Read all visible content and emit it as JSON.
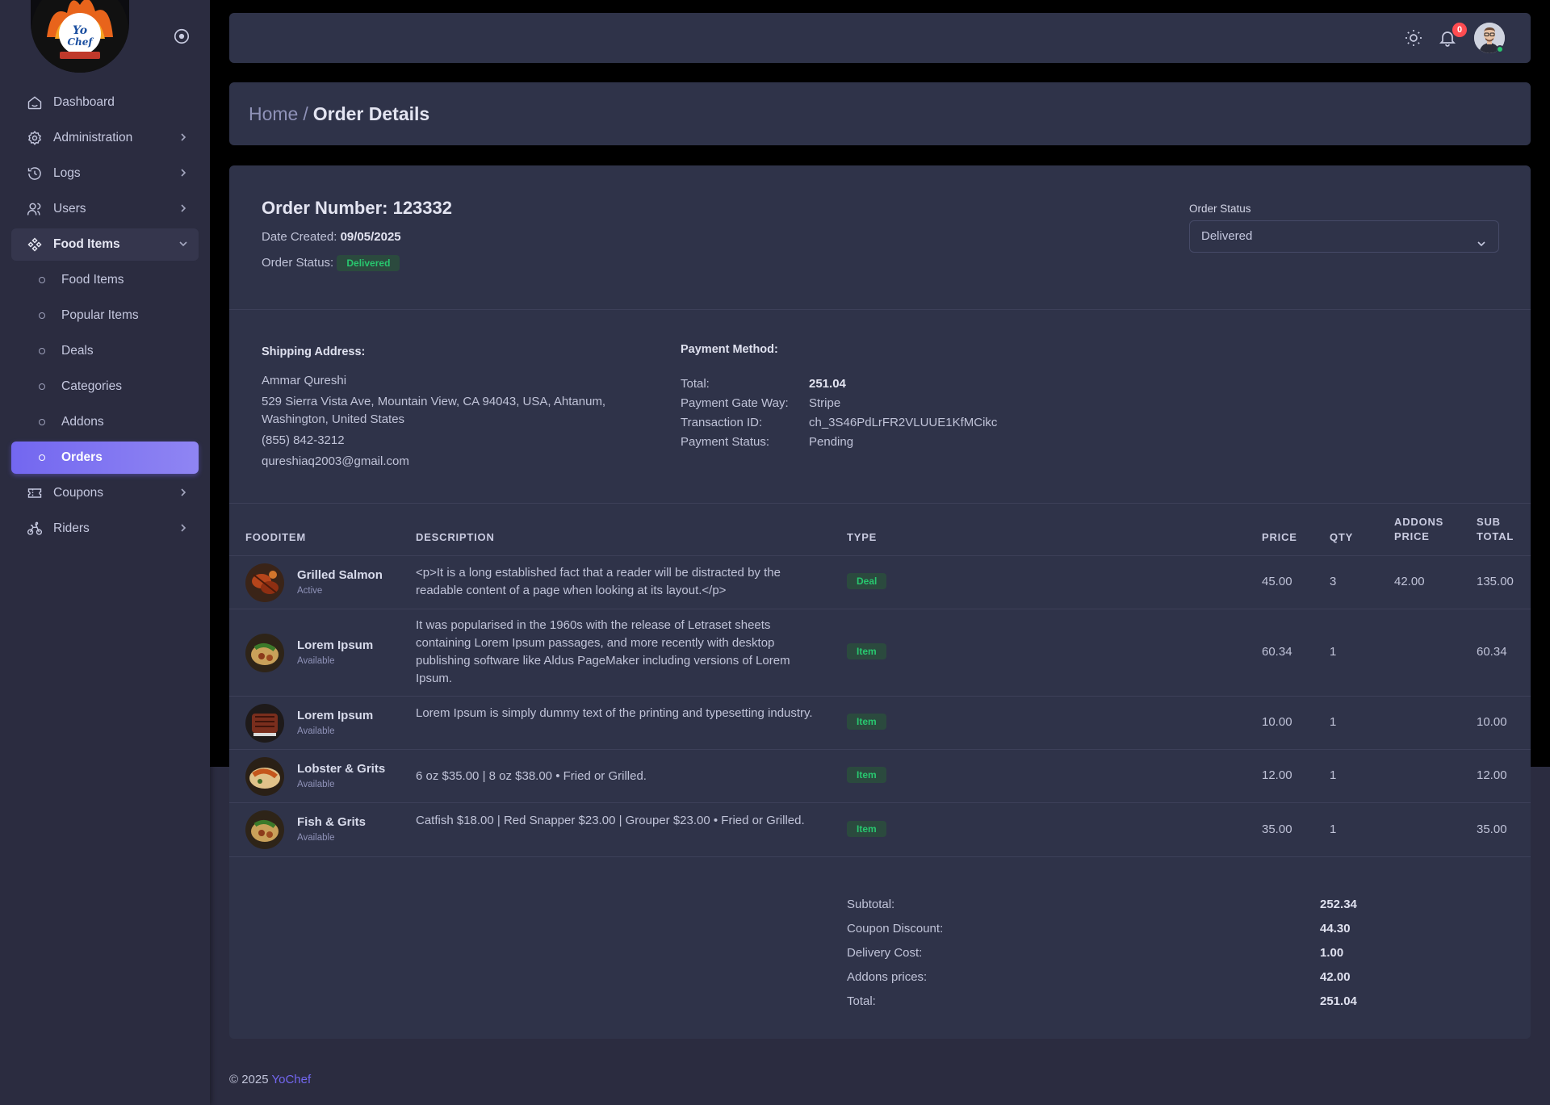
{
  "sidebar": {
    "logo_alt": "YoChef",
    "items": [
      {
        "label": "Dashboard",
        "icon": "home-icon",
        "has_chevron": false
      },
      {
        "label": "Administration",
        "icon": "gear-icon",
        "has_chevron": true
      },
      {
        "label": "Logs",
        "icon": "history-icon",
        "has_chevron": true
      },
      {
        "label": "Users",
        "icon": "users-icon",
        "has_chevron": true
      },
      {
        "label": "Food Items",
        "icon": "food-items-icon",
        "has_chevron": true,
        "open": true
      }
    ],
    "sub_items": [
      {
        "label": "Food Items"
      },
      {
        "label": "Popular Items"
      },
      {
        "label": "Deals"
      },
      {
        "label": "Categories"
      },
      {
        "label": "Addons"
      },
      {
        "label": "Orders",
        "active": true
      }
    ],
    "after_items": [
      {
        "label": "Coupons",
        "icon": "coupon-icon",
        "has_chevron": true
      },
      {
        "label": "Riders",
        "icon": "bike-icon",
        "has_chevron": true
      }
    ]
  },
  "navbar": {
    "notification_count": "0"
  },
  "breadcrumb": {
    "home": "Home",
    "separator": "/",
    "current": "Order Details"
  },
  "order": {
    "title": "Order Number: 123332",
    "date_label": "Date Created:",
    "date_value": "09/05/2025",
    "status_label": "Order Status:",
    "status_value": "Delivered",
    "select_label": "Order Status",
    "select_value": "Delivered"
  },
  "shipping": {
    "title": "Shipping Address:",
    "name": "Ammar Qureshi",
    "address": "529 Sierra Vista Ave, Mountain View, CA 94043, USA, Ahtanum, Washington, United States",
    "phone": "(855) 842-3212",
    "email": "qureshiaq2003@gmail.com"
  },
  "payment": {
    "title": "Payment Method:",
    "rows": [
      {
        "k": "Total:",
        "v": "251.04",
        "bold": true
      },
      {
        "k": "Payment Gate Way:",
        "v": "Stripe",
        "bold": false
      },
      {
        "k": "Transaction ID:",
        "v": "ch_3S46PdLrFR2VLUUE1KfMCikc",
        "bold": false
      },
      {
        "k": "Payment Status:",
        "v": "Pending",
        "bold": false
      }
    ]
  },
  "table": {
    "headers": {
      "fooditem": "FOODITEM",
      "description": "DESCRIPTION",
      "type": "TYPE",
      "price": "PRICE",
      "qty": "QTY",
      "addons_price": "ADDONS PRICE",
      "sub_total": "SUB TOTAL"
    },
    "rows": [
      {
        "name": "Grilled Salmon",
        "status": "Active",
        "description": "<p>It is a long established fact that a reader will be distracted by the readable content of a page when looking at its layout.</p>",
        "type": "Deal",
        "price": "45.00",
        "qty": "3",
        "addons_price": "42.00",
        "sub_total": "135.00"
      },
      {
        "name": "Lorem Ipsum",
        "status": "Available",
        "description": "It was popularised in the 1960s with the release of Letraset sheets containing Lorem Ipsum passages, and more recently with desktop publishing software like Aldus PageMaker including versions of Lorem Ipsum.",
        "type": "Item",
        "price": "60.34",
        "qty": "1",
        "addons_price": "",
        "sub_total": "60.34"
      },
      {
        "name": "Lorem Ipsum",
        "status": "Available",
        "description": "Lorem Ipsum is simply dummy text of the printing and typesetting industry.",
        "type": "Item",
        "price": "10.00",
        "qty": "1",
        "addons_price": "",
        "sub_total": "10.00"
      },
      {
        "name": "Lobster & Grits",
        "status": "Available",
        "description": "6 oz $35.00 | 8 oz $38.00 • Fried or Grilled.",
        "type": "Item",
        "price": "12.00",
        "qty": "1",
        "addons_price": "",
        "sub_total": "12.00"
      },
      {
        "name": "Fish & Grits",
        "status": "Available",
        "description": "Catfish $18.00 | Red Snapper $23.00 | Grouper $23.00 • Fried or Grilled.",
        "type": "Item",
        "price": "35.00",
        "qty": "1",
        "addons_price": "",
        "sub_total": "35.00"
      }
    ]
  },
  "totals": [
    {
      "k": "Subtotal:",
      "v": "252.34"
    },
    {
      "k": "Coupon Discount:",
      "v": "44.30"
    },
    {
      "k": "Delivery Cost:",
      "v": "1.00"
    },
    {
      "k": "Addons prices:",
      "v": "42.00"
    },
    {
      "k": "Total:",
      "v": "251.04"
    }
  ],
  "footer": {
    "copyright": "© 2025",
    "brand": "YoChef"
  },
  "colors": {
    "accent": "#7367f0",
    "success": "#28c76f",
    "danger": "#ff4c51",
    "card": "#2f3349",
    "background": "#2b2c40"
  }
}
